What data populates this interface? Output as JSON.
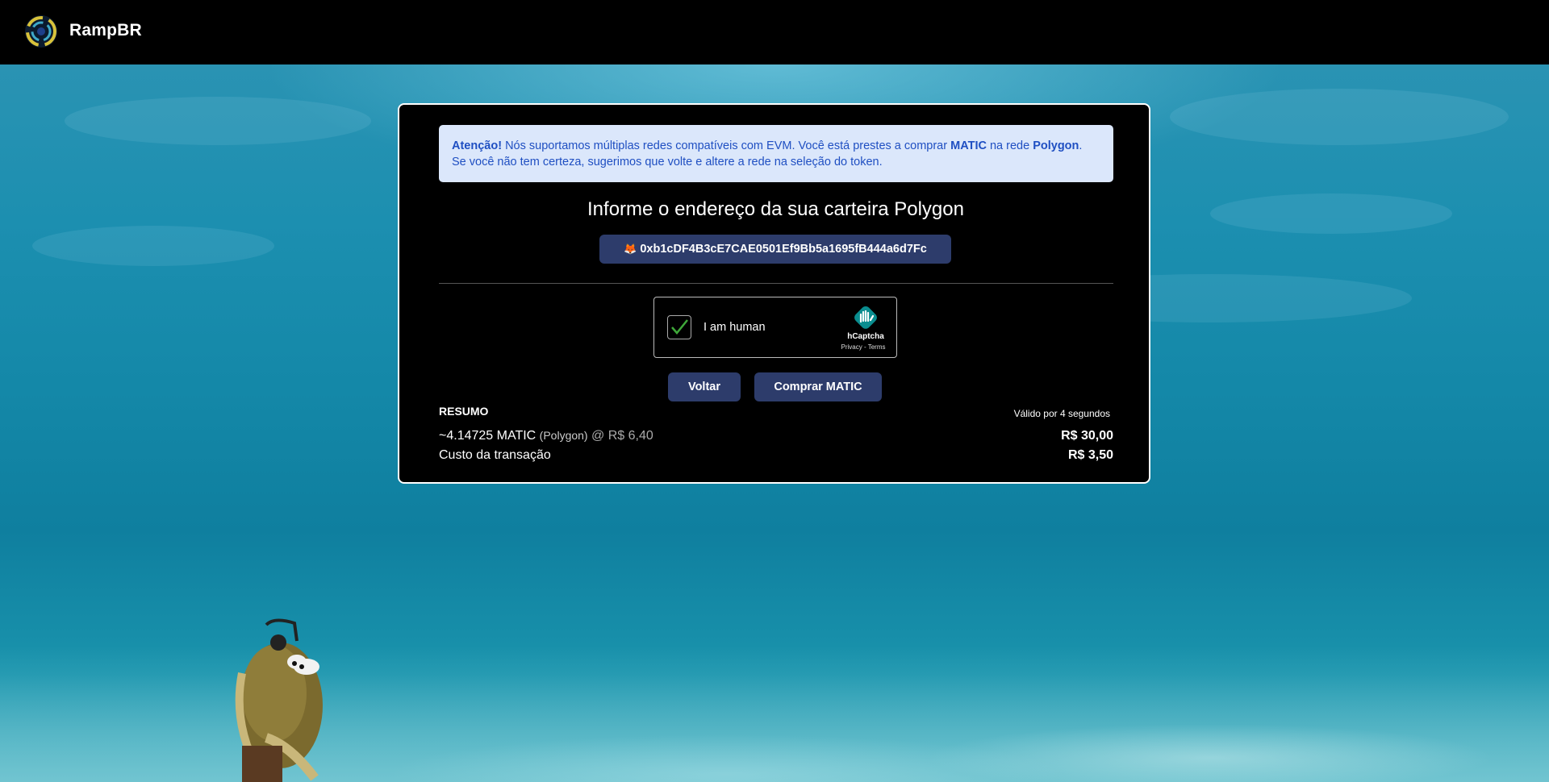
{
  "header": {
    "brand": "RampBR"
  },
  "alert": {
    "strong_prefix": "Atenção!",
    "text1": " Nós suportamos múltiplas redes compatíveis com EVM. Você está prestes a comprar ",
    "token": "MATIC",
    "text2": " na rede ",
    "network": "Polygon",
    "text3": ".",
    "line2": "Se você não tem certeza, sugerimos que volte e altere a rede na seleção do token."
  },
  "main": {
    "title": "Informe o endereço da sua carteira Polygon",
    "wallet_address": "0xb1cDF4B3cE7CAE0501Ef9Bb5a1695fB444a6d7Fc",
    "wallet_icon": "metamask-fox-icon"
  },
  "captcha": {
    "label": "I am human",
    "brand": "hCaptcha",
    "links": "Privacy - Terms",
    "checked": true
  },
  "buttons": {
    "back": "Voltar",
    "buy": "Comprar MATIC"
  },
  "summary": {
    "title": "RESUMO",
    "valid": "Válido por 4 segundos",
    "amount": "~4.14725 MATIC",
    "network": "(Polygon)",
    "rate": "@ R$ 6,40",
    "amount_value": "R$ 30,00",
    "fee_label": "Custo da transação",
    "fee_value": "R$ 3,50"
  },
  "colors": {
    "button_bg": "#2d3c6b",
    "alert_bg": "#dbe7fb",
    "alert_text": "#1f4fc2"
  }
}
